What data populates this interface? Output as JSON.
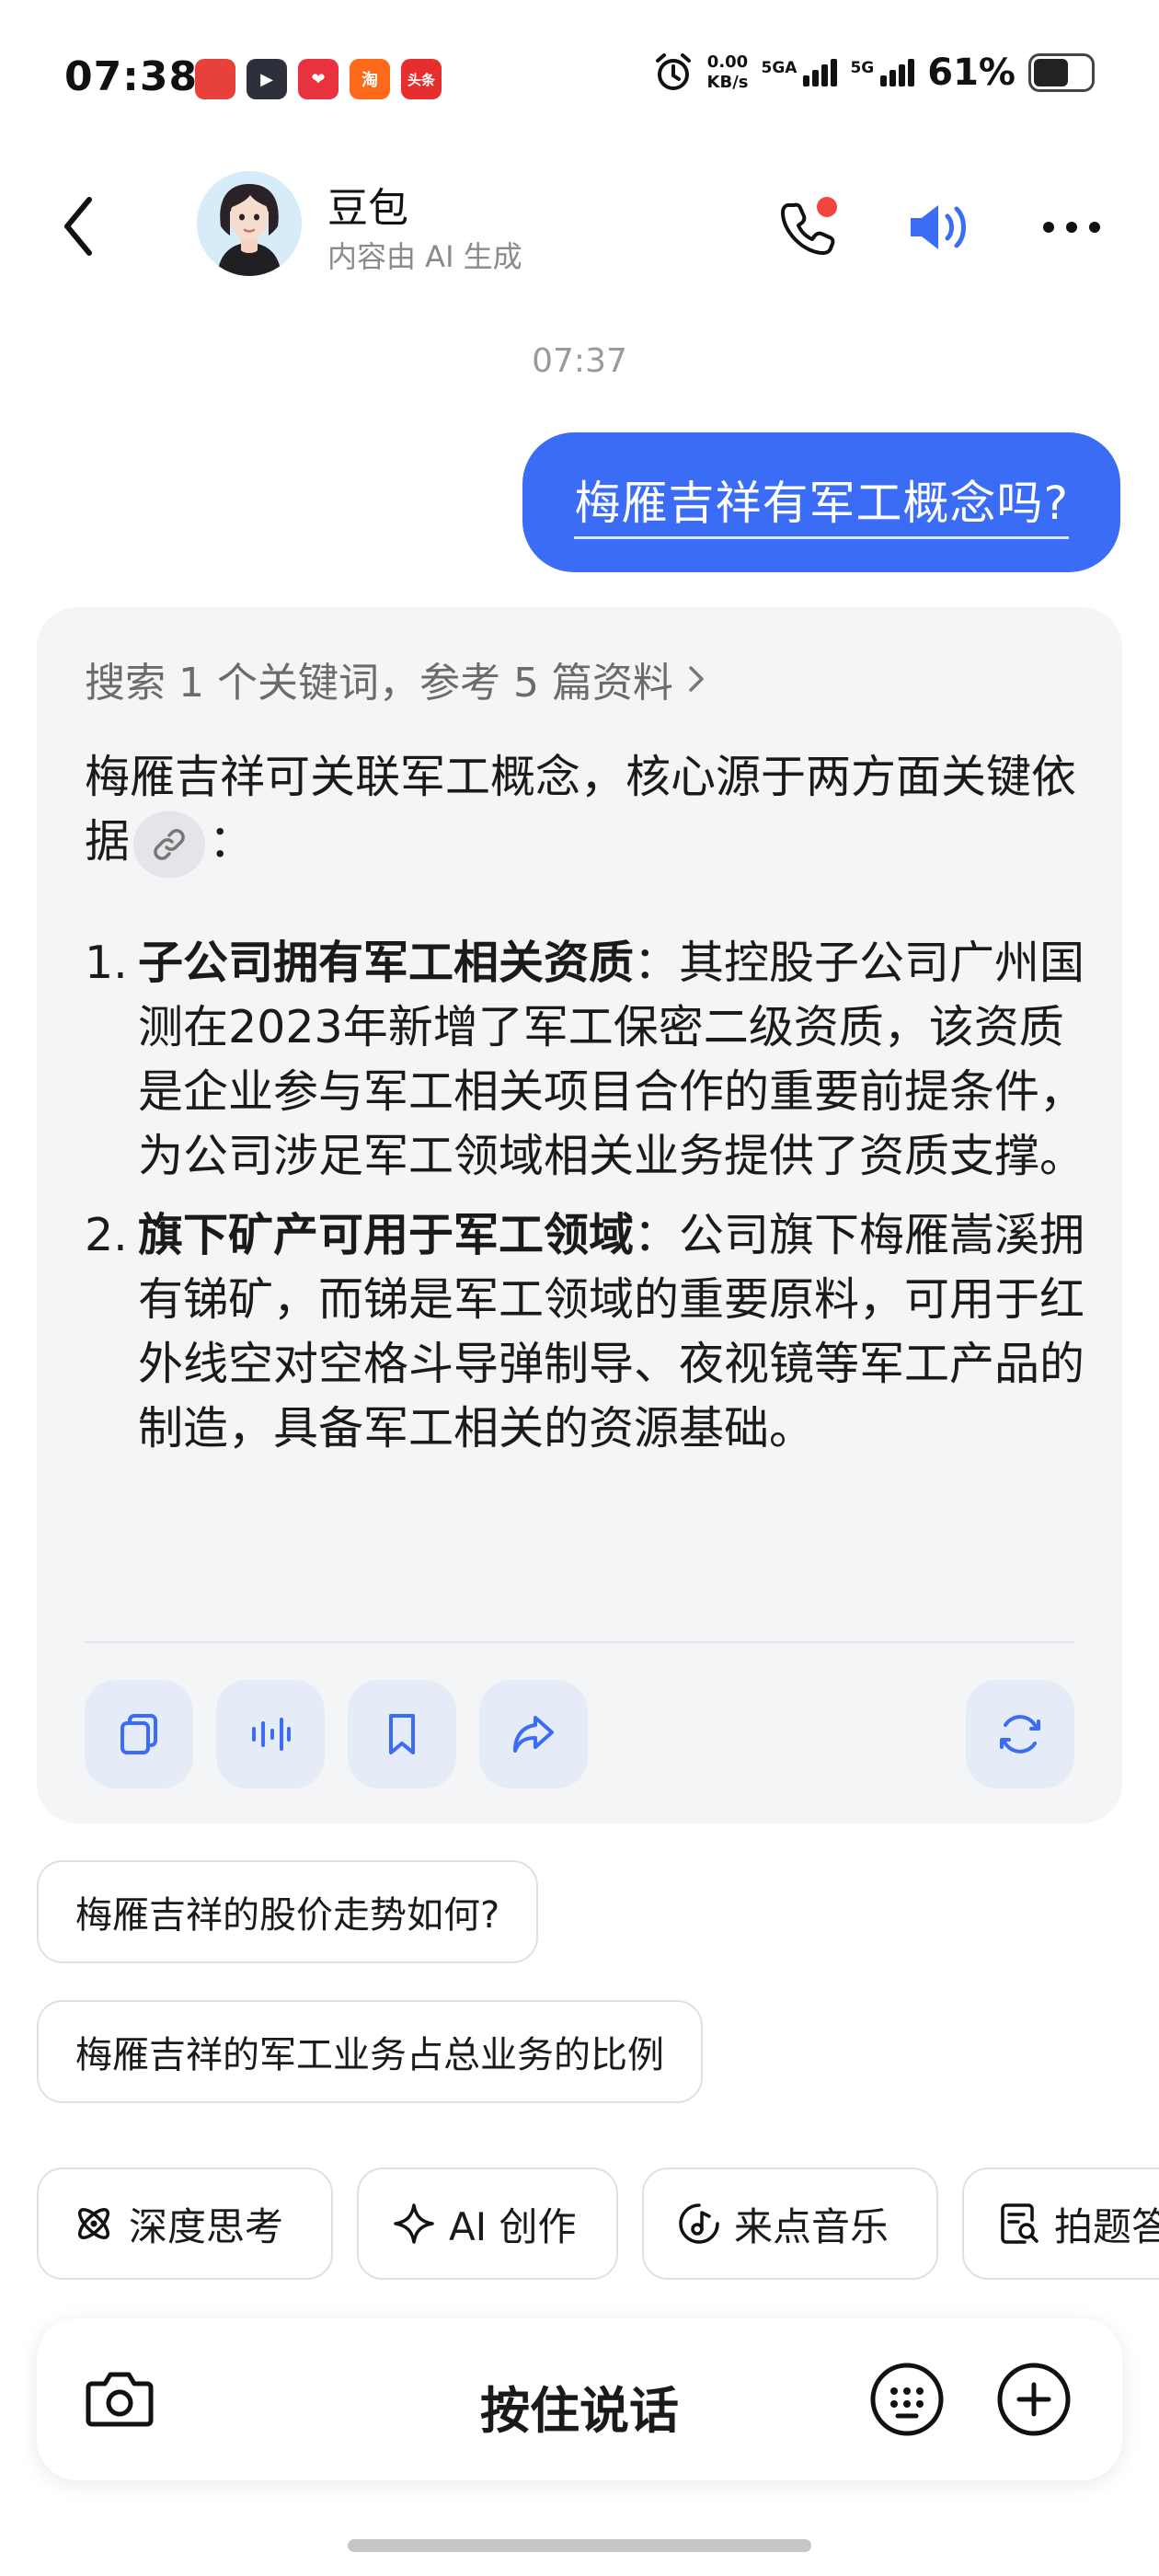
{
  "status_bar": {
    "time": "07:38",
    "app_badges": [
      {
        "label": "",
        "color": "#e8403a"
      },
      {
        "label": "▶",
        "color": "#2d2f3a"
      },
      {
        "label": "❤",
        "color": "#e8333f"
      },
      {
        "label": "淘",
        "color": "#ff6a1a"
      },
      {
        "label": "头条",
        "color": "#e62e2e"
      }
    ],
    "speed_value": "0.00",
    "speed_unit": "KB/s",
    "net1": "5GA",
    "net2": "5G",
    "battery_percent": "61%",
    "battery_level": 0.61
  },
  "header": {
    "title": "豆包",
    "subtitle": "内容由 AI 生成"
  },
  "chat": {
    "timestamp": "07:37",
    "user_message": "梅雁吉祥有军工概念吗?",
    "ai": {
      "search_ref": "搜索 1 个关键词，参考 5 篇资料",
      "intro_text": "梅雁吉祥可关联军工概念，核心源于两方面关键依据",
      "intro_end": "：",
      "items": [
        {
          "num": "1.",
          "bold": "子公司拥有军工相关资质",
          "text": "：其控股子公司广州国测在2023年新增了军工保密二级资质，该资质是企业参与军工相关项目合作的重要前提条件，为公司涉足军工领域相关业务提供了资质支撑。"
        },
        {
          "num": "2.",
          "bold": "旗下矿产可用于军工领域",
          "text": "：公司旗下梅雁嵩溪拥有锑矿，而锑是军工领域的重要原料，可用于红外线空对空格斗导弹制导、夜视镜等军工产品的制造，具备军工相关的资源基础。"
        }
      ]
    }
  },
  "suggestions": [
    "梅雁吉祥的股价走势如何?",
    "梅雁吉祥的军工业务占总业务的比例"
  ],
  "tools": [
    {
      "icon": "atom-icon",
      "label": "深度思考"
    },
    {
      "icon": "sparkle-icon",
      "label": "AI 创作"
    },
    {
      "icon": "music-icon",
      "label": "来点音乐"
    },
    {
      "icon": "photo-question-icon",
      "label": "拍题答疑"
    }
  ],
  "input_bar": {
    "hold_to_talk": "按住说话"
  },
  "colors": {
    "accent": "#3b6cf6",
    "card_bg": "#f4f5f7",
    "action_bg": "#e6ebf8",
    "notification": "#f2453d"
  }
}
